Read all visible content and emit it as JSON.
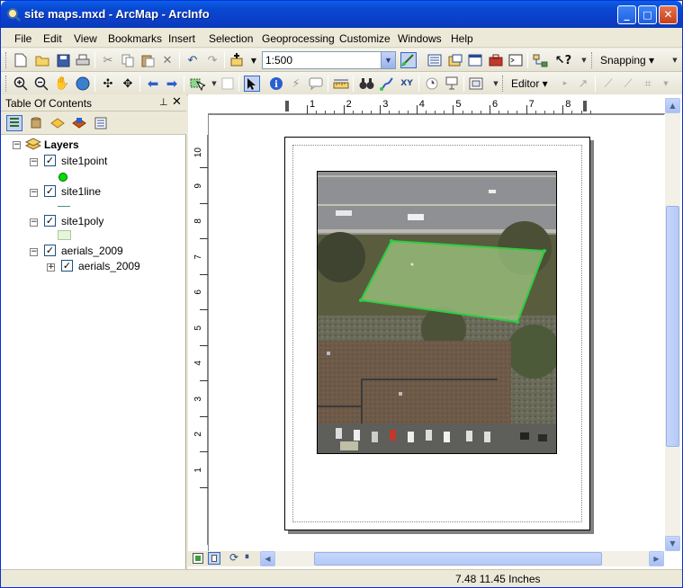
{
  "window": {
    "title": "site maps.mxd - ArcMap - ArcInfo",
    "minimize": "_",
    "maximize": "□",
    "close": "✕"
  },
  "menu": [
    "File",
    "Edit",
    "View",
    "Bookmarks",
    "Insert",
    "Selection",
    "Geoprocessing",
    "Customize",
    "Windows",
    "Help"
  ],
  "toolbar": {
    "scale_value": "1:500",
    "snapping_label": "Snapping ▾",
    "editor_label": "Editor ▾"
  },
  "toc": {
    "title": "Table Of Contents",
    "pin": "⊥",
    "close": "✕",
    "root": "Layers",
    "layers": [
      {
        "name": "site1point",
        "checked": "✓",
        "expander": "−"
      },
      {
        "name": "site1line",
        "checked": "✓",
        "expander": "−"
      },
      {
        "name": "site1poly",
        "checked": "✓",
        "expander": "−"
      },
      {
        "name": "aerials_2009",
        "checked": "✓",
        "expander": "−"
      }
    ],
    "sublayer": {
      "name": "aerials_2009",
      "checked": "✓",
      "expander": "+"
    },
    "symbol_colors": {
      "point": "#00e000",
      "line": "#4a8f8f",
      "poly": "#e8f3dc"
    }
  },
  "ruler": {
    "h_ticks": [
      "1",
      "2",
      "3",
      "4",
      "5",
      "6",
      "7",
      "8"
    ],
    "v_ticks": [
      "10",
      "9",
      "8",
      "7",
      "6",
      "5",
      "4",
      "3",
      "2",
      "1"
    ]
  },
  "status": {
    "coordinates": "7.48  11.45 Inches"
  },
  "colors": {
    "titlebar": "#0a48d2",
    "polygon_outline": "#2ecc40"
  }
}
